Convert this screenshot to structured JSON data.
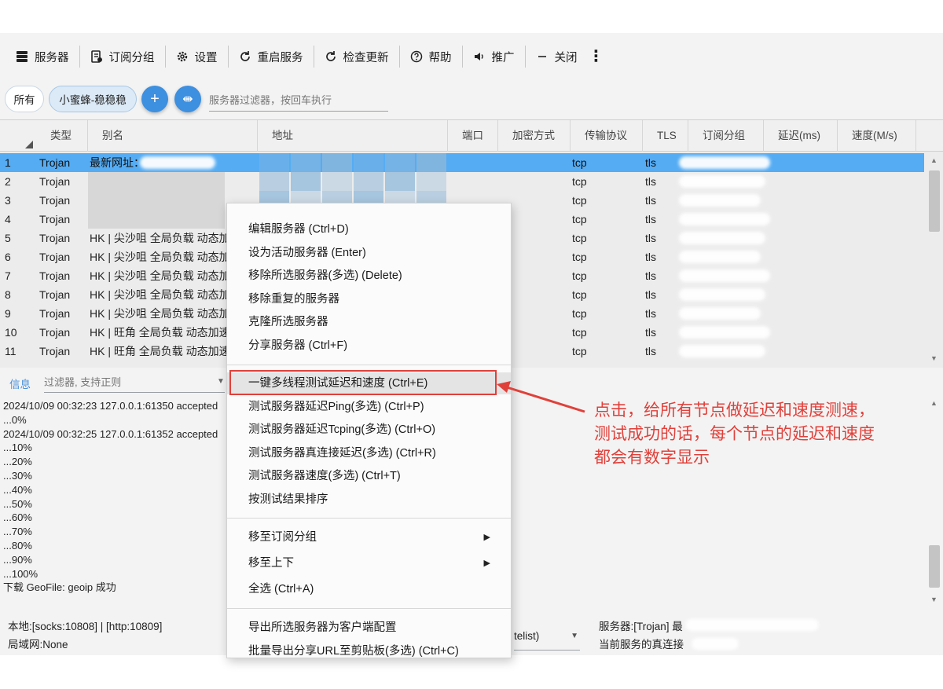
{
  "toolbar": {
    "servers": "服务器",
    "subscription": "订阅分组",
    "settings": "设置",
    "restart": "重启服务",
    "check_update": "检查更新",
    "help": "帮助",
    "promote": "推广",
    "close": "关闭",
    "more": "⋮"
  },
  "filters": {
    "all": "所有",
    "group": "小蜜蜂-稳稳稳",
    "add": "+",
    "tool": "⇼",
    "server_filter_placeholder": "服务器过滤器，按回车执行"
  },
  "grid": {
    "columns": [
      "类型",
      "别名",
      "地址",
      "端口",
      "加密方式",
      "传输协议",
      "TLS",
      "订阅分组",
      "延迟(ms)",
      "速度(M/s)"
    ],
    "rows": [
      {
        "num": "1",
        "type": "Trojan",
        "alias": "最新网址：",
        "network": "tcp",
        "tls": "tls"
      },
      {
        "num": "2",
        "type": "Trojan",
        "alias": "",
        "network": "tcp",
        "tls": "tls"
      },
      {
        "num": "3",
        "type": "Trojan",
        "alias": "",
        "network": "tcp",
        "tls": "tls"
      },
      {
        "num": "4",
        "type": "Trojan",
        "alias": "",
        "network": "tcp",
        "tls": "tls"
      },
      {
        "num": "5",
        "type": "Trojan",
        "alias": "HK | 尖沙咀 全局负载 动态加速",
        "network": "tcp",
        "tls": "tls"
      },
      {
        "num": "6",
        "type": "Trojan",
        "alias": "HK | 尖沙咀 全局负载 动态加速",
        "network": "tcp",
        "tls": "tls"
      },
      {
        "num": "7",
        "type": "Trojan",
        "alias": "HK | 尖沙咀 全局负载 动态加速",
        "network": "tcp",
        "tls": "tls"
      },
      {
        "num": "8",
        "type": "Trojan",
        "alias": "HK | 尖沙咀 全局负载 动态加速",
        "network": "tcp",
        "tls": "tls"
      },
      {
        "num": "9",
        "type": "Trojan",
        "alias": "HK | 尖沙咀 全局负载 动态加速",
        "network": "tcp",
        "tls": "tls"
      },
      {
        "num": "10",
        "type": "Trojan",
        "alias": "HK | 旺角 全局负载 动态加速",
        "network": "tcp",
        "tls": "tls"
      },
      {
        "num": "11",
        "type": "Trojan",
        "alias": "HK | 旺角 全局负载 动态加速",
        "network": "tcp",
        "tls": "tls"
      }
    ]
  },
  "info": {
    "tab": "信息",
    "filter_placeholder": "过滤器, 支持正则",
    "log_lines": [
      "2024/10/09 00:32:23 127.0.0.1:61350 accepted",
      "...0%",
      "2024/10/09 00:32:25 127.0.0.1:61352 accepted",
      "...10%",
      "...20%",
      "...30%",
      "...40%",
      "...50%",
      "...60%",
      "...70%",
      "...80%",
      "...90%",
      "...100%",
      "下载 GeoFile: geoip 成功"
    ]
  },
  "status": {
    "local": "本地:[socks:10808] | [http:10809]",
    "lan": "局域网:None",
    "routing": "telist)",
    "server": "服务器:[Trojan] 最",
    "current_delay": "当前服务的真连接"
  },
  "context_menu": {
    "group1": [
      "编辑服务器 (Ctrl+D)",
      "设为活动服务器 (Enter)",
      "移除所选服务器(多选) (Delete)",
      "移除重复的服务器",
      "克隆所选服务器",
      "分享服务器 (Ctrl+F)"
    ],
    "group2": [
      "一键多线程测试延迟和速度 (Ctrl+E)",
      "测试服务器延迟Ping(多选) (Ctrl+P)",
      "测试服务器延迟Tcping(多选) (Ctrl+O)",
      "测试服务器真连接延迟(多选) (Ctrl+R)",
      "测试服务器速度(多选) (Ctrl+T)",
      "按测试结果排序"
    ],
    "group3": [
      "移至订阅分组",
      "移至上下",
      "全选 (Ctrl+A)"
    ],
    "group4": [
      "导出所选服务器为客户端配置",
      "批量导出分享URL至剪贴板(多选) (Ctrl+C)"
    ],
    "submenu_arrow": "▶"
  },
  "annotation": {
    "lines": [
      "点击，给所有节点做延迟和速度测速，",
      "测试成功的话，每个节点的延迟和速度",
      "都会有数字显示"
    ],
    "color": "#e0403a"
  },
  "colors": {
    "selected_row": "#55acf3",
    "accent": "#3d8fe0"
  }
}
